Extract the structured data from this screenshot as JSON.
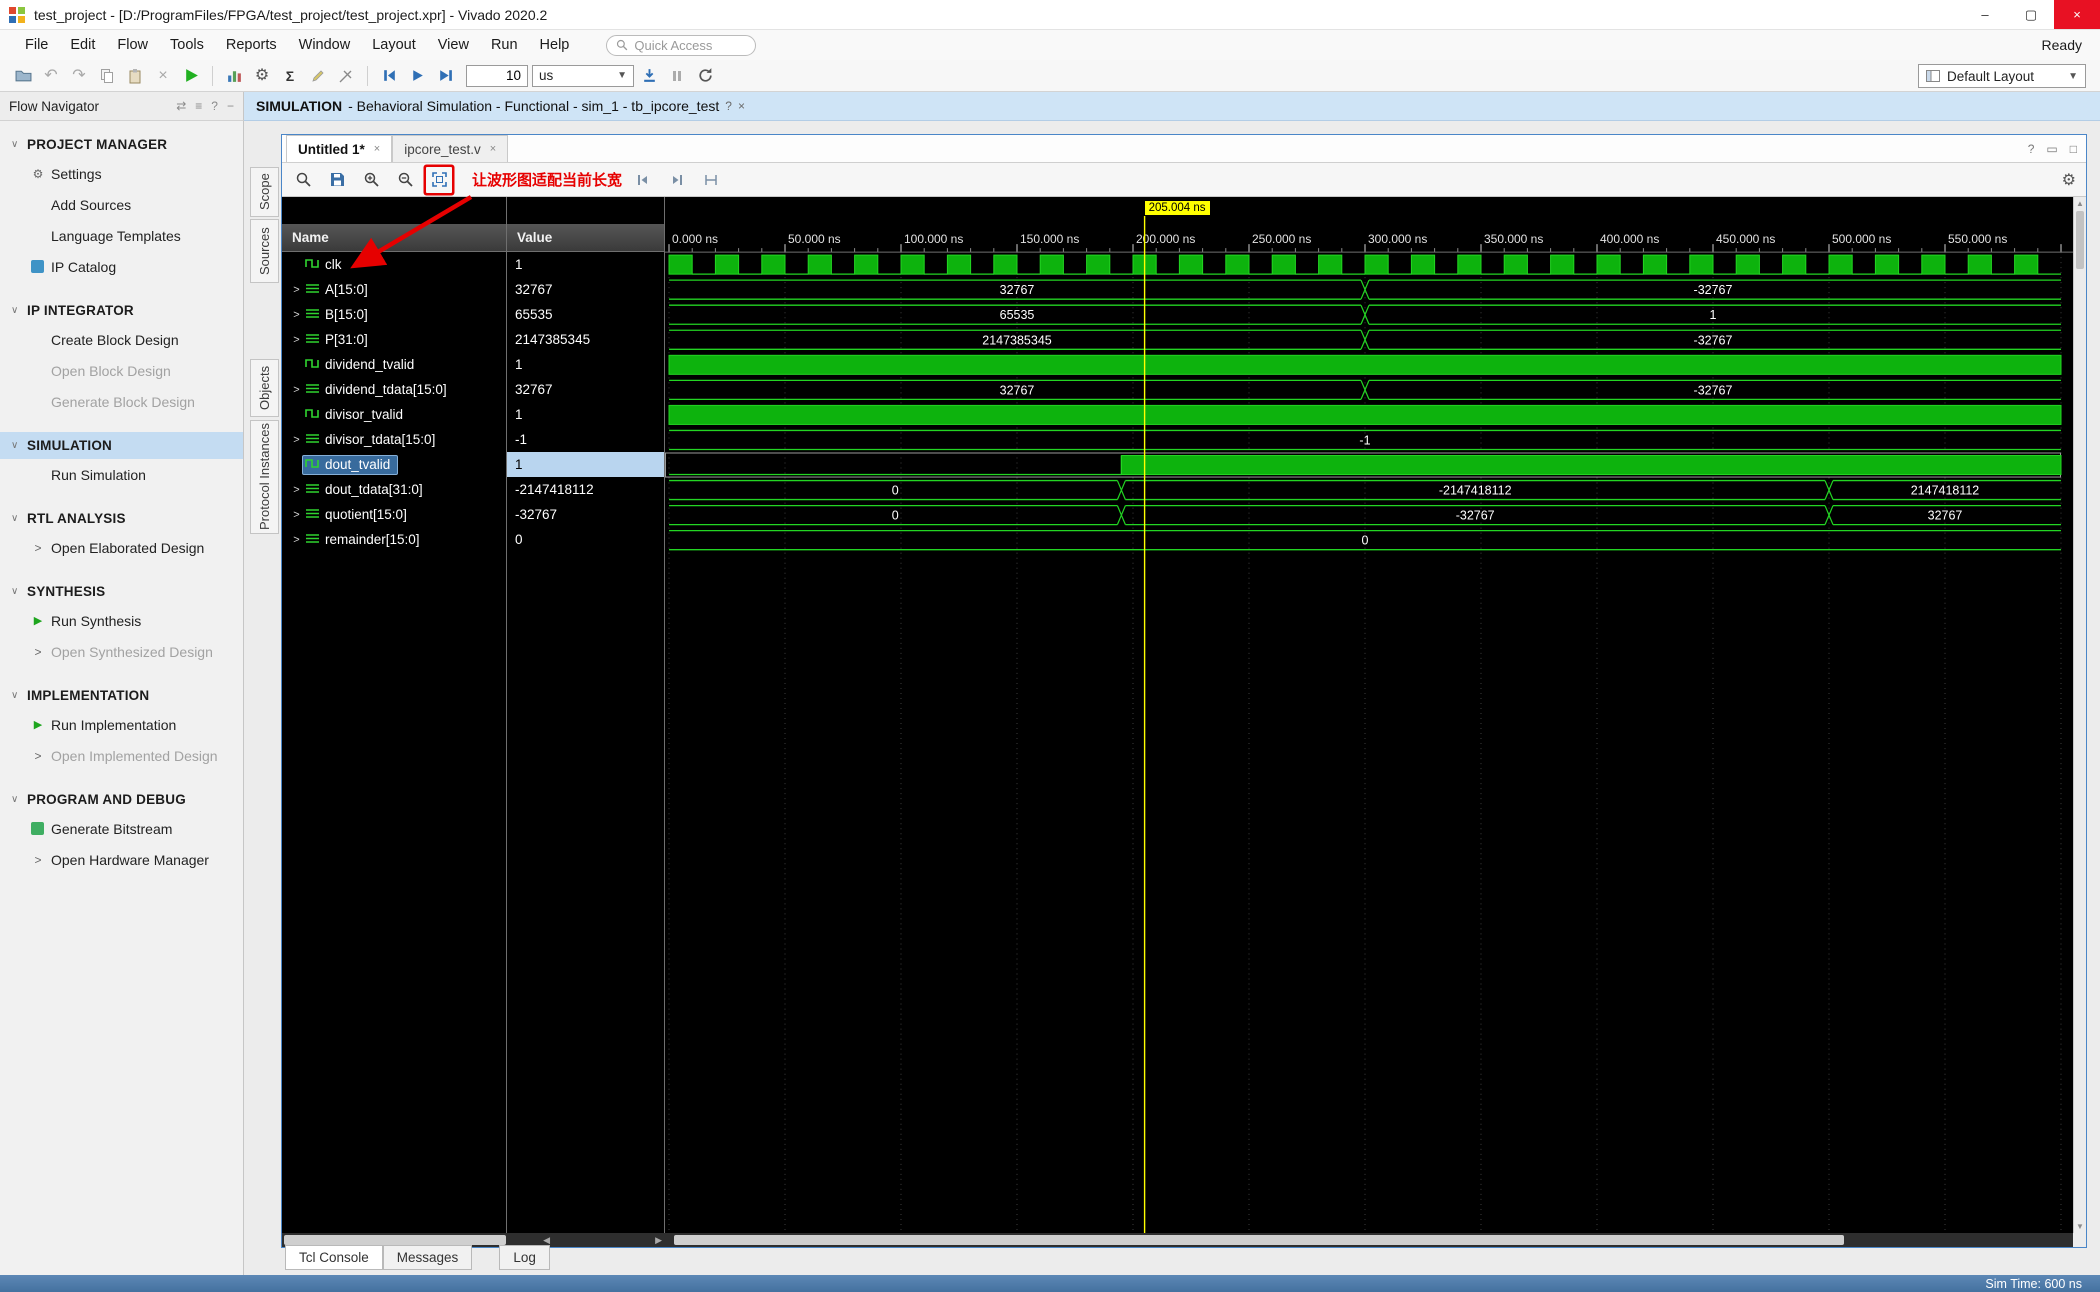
{
  "titlebar": {
    "title": "test_project - [D:/ProgramFiles/FPGA/test_project/test_project.xpr] - Vivado 2020.2"
  },
  "menubar": {
    "items": [
      "File",
      "Edit",
      "Flow",
      "Tools",
      "Reports",
      "Window",
      "Layout",
      "View",
      "Run",
      "Help"
    ],
    "quick_access": "Quick Access",
    "ready": "Ready"
  },
  "toolbar": {
    "time_value": "10",
    "time_unit": "us",
    "layout": "Default Layout"
  },
  "banner": {
    "title": "SIMULATION",
    "subtitle": "- Behavioral Simulation - Functional - sim_1 - tb_ipcore_test"
  },
  "flow_navigator": {
    "title": "Flow Navigator",
    "sections": [
      {
        "label": "PROJECT MANAGER",
        "items": [
          {
            "label": "Settings",
            "icon": "gear",
            "enabled": true
          },
          {
            "label": "Add Sources",
            "enabled": true
          },
          {
            "label": "Language Templates",
            "enabled": true
          },
          {
            "label": "IP Catalog",
            "icon": "ip",
            "enabled": true
          }
        ]
      },
      {
        "label": "IP INTEGRATOR",
        "items": [
          {
            "label": "Create Block Design",
            "enabled": true
          },
          {
            "label": "Open Block Design",
            "enabled": false
          },
          {
            "label": "Generate Block Design",
            "enabled": false
          }
        ]
      },
      {
        "label": "SIMULATION",
        "selected": true,
        "items": [
          {
            "label": "Run Simulation",
            "enabled": true
          }
        ]
      },
      {
        "label": "RTL ANALYSIS",
        "items": [
          {
            "label": "Open Elaborated Design",
            "arrow": true,
            "enabled": true
          }
        ]
      },
      {
        "label": "SYNTHESIS",
        "items": [
          {
            "label": "Run Synthesis",
            "icon": "run",
            "enabled": true
          },
          {
            "label": "Open Synthesized Design",
            "arrow": true,
            "enabled": false
          }
        ]
      },
      {
        "label": "IMPLEMENTATION",
        "items": [
          {
            "label": "Run Implementation",
            "icon": "run",
            "enabled": true
          },
          {
            "label": "Open Implemented Design",
            "arrow": true,
            "enabled": false
          }
        ]
      },
      {
        "label": "PROGRAM AND DEBUG",
        "items": [
          {
            "label": "Generate Bitstream",
            "icon": "bitstream",
            "enabled": true
          },
          {
            "label": "Open Hardware Manager",
            "arrow": true,
            "enabled": true
          }
        ]
      }
    ]
  },
  "side_tabs": [
    "Scope",
    "Sources",
    "Objects",
    "Protocol Instances"
  ],
  "doc_tabs": [
    {
      "label": "Untitled 1*",
      "active": true
    },
    {
      "label": "ipcore_test.v",
      "active": false
    }
  ],
  "annotation": {
    "text": "让波形图适配当前长宽",
    "color": "#e60000"
  },
  "console_tabs": [
    "Tcl Console",
    "Messages",
    "Log"
  ],
  "statusbar": {
    "sim_time": "Sim Time: 600 ns"
  },
  "icons": {
    "minimize": "–",
    "maximize": "▢",
    "close": "×",
    "close_small": "×",
    "caret": "▼",
    "section_chevron": "∨",
    "expand_arrow": ">",
    "play": "▶",
    "help": "?",
    "float": "▭",
    "max_panel": "□",
    "gear": "⚙",
    "sigma": "Σ",
    "undo": "↶",
    "redo": "↷",
    "delete": "×",
    "dock": "⇄",
    "menu": "≡",
    "minus": "−",
    "up": "▲",
    "down": "▼",
    "left": "◀",
    "right": "▶"
  },
  "waveform": {
    "name_header": "Name",
    "value_header": "Value",
    "cursor": {
      "time": 205.004,
      "label": "205.004 ns"
    },
    "time_start": 0,
    "time_end": 600,
    "tick_interval": 50,
    "tick_labels": [
      "0.000 ns",
      "50.000 ns",
      "100.000 ns",
      "150.000 ns",
      "200.000 ns",
      "250.000 ns",
      "300.000 ns",
      "350.000 ns",
      "400.000 ns",
      "450.000 ns",
      "500.000 ns",
      "550.000 ns"
    ],
    "signals": [
      {
        "name": "clk",
        "value": "1",
        "type": "clock",
        "period": 20
      },
      {
        "name": "A[15:0]",
        "value": "32767",
        "type": "bus",
        "segments": [
          {
            "t0": 0,
            "t1": 300,
            "label": "32767"
          },
          {
            "t0": 300,
            "t1": 600,
            "label": "-32767"
          }
        ]
      },
      {
        "name": "B[15:0]",
        "value": "65535",
        "type": "bus",
        "segments": [
          {
            "t0": 0,
            "t1": 300,
            "label": "65535"
          },
          {
            "t0": 300,
            "t1": 600,
            "label": "1"
          }
        ]
      },
      {
        "name": "P[31:0]",
        "value": "2147385345",
        "type": "bus",
        "segments": [
          {
            "t0": 0,
            "t1": 300,
            "label": "2147385345"
          },
          {
            "t0": 300,
            "t1": 600,
            "label": "-32767"
          }
        ]
      },
      {
        "name": "dividend_tvalid",
        "value": "1",
        "type": "bit",
        "segments": [
          {
            "t0": 0,
            "t1": 600,
            "level": 1
          }
        ]
      },
      {
        "name": "dividend_tdata[15:0]",
        "value": "32767",
        "type": "bus",
        "segments": [
          {
            "t0": 0,
            "t1": 300,
            "label": "32767"
          },
          {
            "t0": 300,
            "t1": 600,
            "label": "-32767"
          }
        ]
      },
      {
        "name": "divisor_tvalid",
        "value": "1",
        "type": "bit",
        "segments": [
          {
            "t0": 0,
            "t1": 600,
            "level": 1
          }
        ]
      },
      {
        "name": "divisor_tdata[15:0]",
        "value": "-1",
        "type": "bus",
        "segments": [
          {
            "t0": 0,
            "t1": 600,
            "label": "-1"
          }
        ]
      },
      {
        "name": "dout_tvalid",
        "value": "1",
        "type": "bit",
        "selected": true,
        "segments": [
          {
            "t0": 0,
            "t1": 195,
            "level": 0
          },
          {
            "t0": 195,
            "t1": 600,
            "level": 1
          }
        ]
      },
      {
        "name": "dout_tdata[31:0]",
        "value": "-2147418112",
        "type": "bus",
        "segments": [
          {
            "t0": 0,
            "t1": 195,
            "label": "0"
          },
          {
            "t0": 195,
            "t1": 500,
            "label": "-2147418112"
          },
          {
            "t0": 500,
            "t1": 600,
            "label": "2147418112"
          }
        ]
      },
      {
        "name": "quotient[15:0]",
        "value": "-32767",
        "type": "bus",
        "segments": [
          {
            "t0": 0,
            "t1": 195,
            "label": "0"
          },
          {
            "t0": 195,
            "t1": 500,
            "label": "-32767"
          },
          {
            "t0": 500,
            "t1": 600,
            "label": "32767"
          }
        ]
      },
      {
        "name": "remainder[15:0]",
        "value": "0",
        "type": "bus",
        "segments": [
          {
            "t0": 0,
            "t1": 600,
            "label": "0"
          }
        ]
      }
    ]
  }
}
